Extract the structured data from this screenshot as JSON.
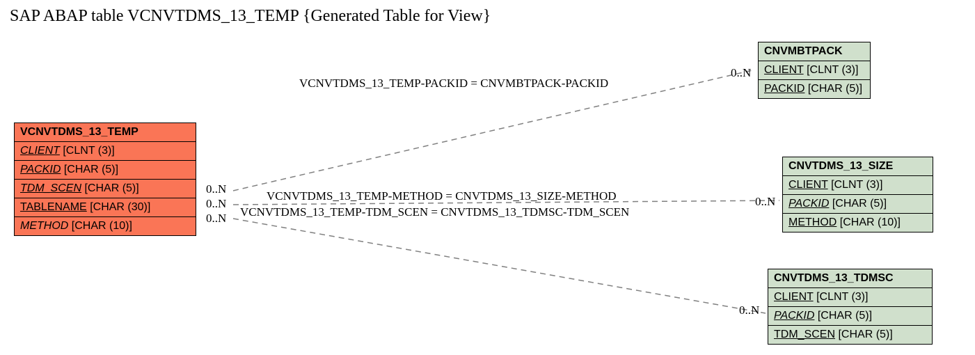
{
  "title": "SAP ABAP table VCNVTDMS_13_TEMP {Generated Table for View}",
  "tables": {
    "main": {
      "name": "VCNVTDMS_13_TEMP",
      "fields": [
        {
          "name": "CLIENT",
          "type": "[CLNT (3)]",
          "under": true,
          "ital": true
        },
        {
          "name": "PACKID",
          "type": "[CHAR (5)]",
          "under": true,
          "ital": true
        },
        {
          "name": "TDM_SCEN",
          "type": "[CHAR (5)]",
          "under": true,
          "ital": true
        },
        {
          "name": "TABLENAME",
          "type": "[CHAR (30)]",
          "under": true,
          "ital": false
        },
        {
          "name": "METHOD",
          "type": "[CHAR (10)]",
          "under": false,
          "ital": true
        }
      ]
    },
    "t1": {
      "name": "CNVMBTPACK",
      "fields": [
        {
          "name": "CLIENT",
          "type": "[CLNT (3)]",
          "under": true,
          "ital": false
        },
        {
          "name": "PACKID",
          "type": "[CHAR (5)]",
          "under": true,
          "ital": false
        }
      ]
    },
    "t2": {
      "name": "CNVTDMS_13_SIZE",
      "fields": [
        {
          "name": "CLIENT",
          "type": "[CLNT (3)]",
          "under": true,
          "ital": false
        },
        {
          "name": "PACKID",
          "type": "[CHAR (5)]",
          "under": true,
          "ital": true
        },
        {
          "name": "METHOD",
          "type": "[CHAR (10)]",
          "under": true,
          "ital": false
        }
      ]
    },
    "t3": {
      "name": "CNVTDMS_13_TDMSC",
      "fields": [
        {
          "name": "CLIENT",
          "type": "[CLNT (3)]",
          "under": true,
          "ital": false
        },
        {
          "name": "PACKID",
          "type": "[CHAR (5)]",
          "under": true,
          "ital": true
        },
        {
          "name": "TDM_SCEN",
          "type": "[CHAR (5)]",
          "under": true,
          "ital": false
        }
      ]
    }
  },
  "relations": {
    "r1": "VCNVTDMS_13_TEMP-PACKID = CNVMBTPACK-PACKID",
    "r2": "VCNVTDMS_13_TEMP-METHOD = CNVTDMS_13_SIZE-METHOD",
    "r3": "VCNVTDMS_13_TEMP-TDM_SCEN = CNVTDMS_13_TDMSC-TDM_SCEN"
  },
  "cardinality": {
    "left1": "0..N",
    "left2": "0..N",
    "left3": "0..N",
    "right1": "0..N",
    "right2": "0..N",
    "right3": "0..N"
  }
}
